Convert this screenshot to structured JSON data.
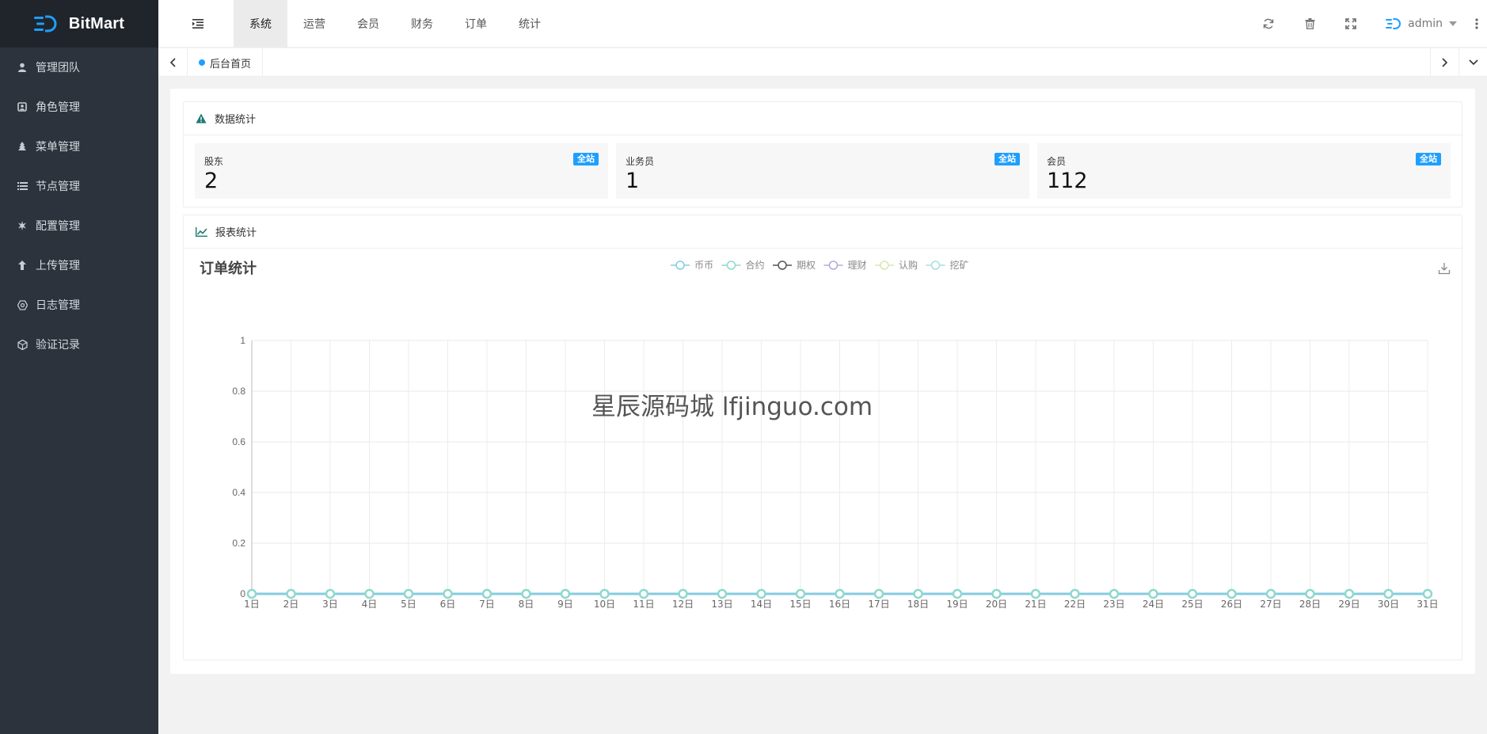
{
  "app": {
    "name": "BitMart",
    "brand_color": "#1e9fff"
  },
  "sidebar": {
    "items": [
      {
        "label": "管理团队",
        "icon": "user-icon"
      },
      {
        "label": "角色管理",
        "icon": "role-icon"
      },
      {
        "label": "菜单管理",
        "icon": "tree-icon"
      },
      {
        "label": "节点管理",
        "icon": "list-icon"
      },
      {
        "label": "配置管理",
        "icon": "gear-icon"
      },
      {
        "label": "上传管理",
        "icon": "upload-icon"
      },
      {
        "label": "日志管理",
        "icon": "log-icon"
      },
      {
        "label": "验证记录",
        "icon": "verify-icon"
      }
    ]
  },
  "header": {
    "tabs": [
      "系统",
      "运营",
      "会员",
      "财务",
      "订单",
      "统计"
    ],
    "active_tab": "系统",
    "user": "admin",
    "tool_icons": [
      "refresh-icon",
      "trash-icon",
      "fullscreen-icon"
    ]
  },
  "tabstrip": {
    "current": "后台首页"
  },
  "stats_panel": {
    "title": "数据统计",
    "cards": [
      {
        "label": "股东",
        "value": "2",
        "badge": "全站"
      },
      {
        "label": "业务员",
        "value": "1",
        "badge": "全站"
      },
      {
        "label": "会员",
        "value": "112",
        "badge": "全站"
      }
    ]
  },
  "report_panel": {
    "title": "报表统计"
  },
  "watermark": "星辰源码城  lfjinguo.com",
  "chart_data": {
    "type": "line",
    "title": "订单统计",
    "categories": [
      "1日",
      "2日",
      "3日",
      "4日",
      "5日",
      "6日",
      "7日",
      "8日",
      "9日",
      "10日",
      "11日",
      "12日",
      "13日",
      "14日",
      "15日",
      "16日",
      "17日",
      "18日",
      "19日",
      "20日",
      "21日",
      "22日",
      "23日",
      "24日",
      "25日",
      "26日",
      "27日",
      "28日",
      "29日",
      "30日",
      "31日"
    ],
    "series": [
      {
        "name": "币币",
        "color": "#86cbe0",
        "values": [
          0,
          0,
          0,
          0,
          0,
          0,
          0,
          0,
          0,
          0,
          0,
          0,
          0,
          0,
          0,
          0,
          0,
          0,
          0,
          0,
          0,
          0,
          0,
          0,
          0,
          0,
          0,
          0,
          0,
          0,
          0
        ]
      },
      {
        "name": "合约",
        "color": "#8cd9cc",
        "values": [
          0,
          0,
          0,
          0,
          0,
          0,
          0,
          0,
          0,
          0,
          0,
          0,
          0,
          0,
          0,
          0,
          0,
          0,
          0,
          0,
          0,
          0,
          0,
          0,
          0,
          0,
          0,
          0,
          0,
          0,
          0
        ]
      },
      {
        "name": "期权",
        "color": "#555555",
        "values": [
          0,
          0,
          0,
          0,
          0,
          0,
          0,
          0,
          0,
          0,
          0,
          0,
          0,
          0,
          0,
          0,
          0,
          0,
          0,
          0,
          0,
          0,
          0,
          0,
          0,
          0,
          0,
          0,
          0,
          0,
          0
        ]
      },
      {
        "name": "理财",
        "color": "#b5a9d9",
        "values": [
          0,
          0,
          0,
          0,
          0,
          0,
          0,
          0,
          0,
          0,
          0,
          0,
          0,
          0,
          0,
          0,
          0,
          0,
          0,
          0,
          0,
          0,
          0,
          0,
          0,
          0,
          0,
          0,
          0,
          0,
          0
        ]
      },
      {
        "name": "认购",
        "color": "#d6e8b0",
        "values": [
          0,
          0,
          0,
          0,
          0,
          0,
          0,
          0,
          0,
          0,
          0,
          0,
          0,
          0,
          0,
          0,
          0,
          0,
          0,
          0,
          0,
          0,
          0,
          0,
          0,
          0,
          0,
          0,
          0,
          0,
          0
        ]
      },
      {
        "name": "挖矿",
        "color": "#a8dde2",
        "values": [
          0,
          0,
          0,
          0,
          0,
          0,
          0,
          0,
          0,
          0,
          0,
          0,
          0,
          0,
          0,
          0,
          0,
          0,
          0,
          0,
          0,
          0,
          0,
          0,
          0,
          0,
          0,
          0,
          0,
          0,
          0
        ]
      }
    ],
    "yticks": [
      0,
      0.2,
      0.4,
      0.6,
      0.8,
      1
    ],
    "ylim": [
      0,
      1
    ],
    "grid": true,
    "legend": "top-center"
  }
}
